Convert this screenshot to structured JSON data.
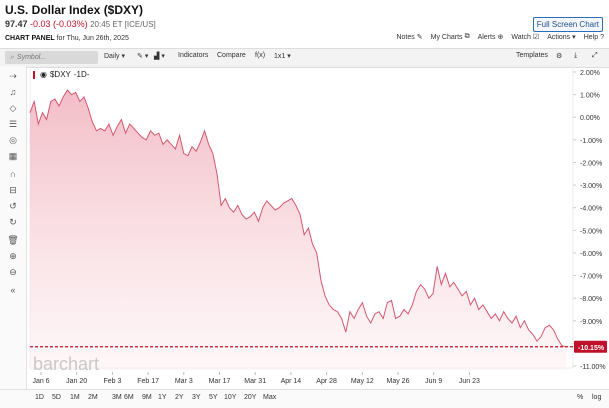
{
  "header": {
    "title": "U.S. Dollar Index ($DXY)",
    "last": "97.47",
    "change": "-0.03 (-0.03%)",
    "timestamp": "20:45 ET [ICE/US]",
    "full_screen_label": "Full Screen Chart"
  },
  "panel": {
    "label": "CHART PANEL",
    "date_text": "for Thu, Jun 26th, 2025"
  },
  "top_links": {
    "notes": "Notes",
    "my_charts": "My Charts",
    "alerts": "Alerts",
    "watch": "Watch",
    "actions": "Actions",
    "help": "Help"
  },
  "toolbar": {
    "symbol_placeholder": "Symbol...",
    "period": "Daily",
    "indicators": "Indicators",
    "compare": "Compare",
    "fx": "f(x)",
    "layout": "1x1",
    "templates": "Templates"
  },
  "legend": {
    "symbol": "$DXY",
    "interval": "-1D-"
  },
  "watermark": "barchart",
  "ranges": [
    "1D",
    "5D",
    "1M",
    "2M",
    "3M",
    "6M",
    "9M",
    "1Y",
    "2Y",
    "3Y",
    "5Y",
    "10Y",
    "20Y",
    "Max"
  ],
  "scale_options": {
    "percent": "%",
    "log": "log"
  },
  "colors": {
    "line": "#d4576f",
    "area_top": "#f2b9c3",
    "marker": "#c0112a"
  },
  "chart_data": {
    "type": "area",
    "x_tick_labels": [
      "Jan 6",
      "Jan 20",
      "Feb 3",
      "Feb 17",
      "Mar 3",
      "Mar 17",
      "Mar 31",
      "Apr 14",
      "Apr 28",
      "May 12",
      "May 26",
      "Jun 9",
      "Jun 23"
    ],
    "y_tick_labels": [
      "2.00%",
      "1.00%",
      "0.00%",
      "-1.00%",
      "-2.00%",
      "-3.00%",
      "-4.00%",
      "-5.00%",
      "-6.00%",
      "-7.00%",
      "-8.00%",
      "-9.00%",
      "-10.00%",
      "-11.00%"
    ],
    "ylim": [
      -11,
      2
    ],
    "unit": "%",
    "last_value_label": "-10.15%",
    "last_value": -10.15,
    "values": [
      0.2,
      0.7,
      -0.3,
      0.2,
      -0.1,
      0.7,
      0.8,
      0.5,
      0.9,
      1.2,
      1.0,
      1.1,
      0.7,
      0.9,
      0.4,
      -0.2,
      -0.6,
      -0.5,
      -0.6,
      -0.3,
      -0.8,
      -0.4,
      -0.1,
      -0.7,
      -0.3,
      -0.5,
      -0.7,
      -0.9,
      -1.0,
      -0.6,
      -0.8,
      -0.7,
      -1.2,
      -1.0,
      -1.2,
      -1.4,
      -0.8,
      -1.6,
      -1.7,
      -1.3,
      -1.5,
      -1.1,
      -0.6,
      -1.2,
      -1.6,
      -2.5,
      -3.9,
      -3.6,
      -4.0,
      -4.2,
      -3.9,
      -4.3,
      -4.5,
      -4.4,
      -4.2,
      -4.6,
      -4.0,
      -3.7,
      -3.9,
      -4.1,
      -4.0,
      -3.8,
      -3.7,
      -3.6,
      -3.9,
      -4.3,
      -5.2,
      -4.9,
      -5.6,
      -6.0,
      -7.2,
      -7.9,
      -8.3,
      -8.5,
      -8.6,
      -8.9,
      -9.5,
      -8.6,
      -8.9,
      -8.5,
      -8.2,
      -8.8,
      -9.1,
      -8.7,
      -8.6,
      -8.9,
      -8.2,
      -8.1,
      -8.9,
      -8.8,
      -8.5,
      -8.7,
      -8.3,
      -7.7,
      -7.4,
      -7.6,
      -8.0,
      -7.8,
      -6.6,
      -7.4,
      -6.9,
      -7.5,
      -7.3,
      -7.6,
      -7.9,
      -7.7,
      -8.3,
      -8.0,
      -8.5,
      -8.3,
      -8.6,
      -8.9,
      -8.7,
      -9.0,
      -8.6,
      -8.9,
      -9.1,
      -8.8,
      -9.3,
      -9.0,
      -9.4,
      -9.6,
      -9.9,
      -9.7,
      -9.3,
      -9.2,
      -9.4,
      -9.8,
      -10.1,
      -10.15
    ]
  }
}
